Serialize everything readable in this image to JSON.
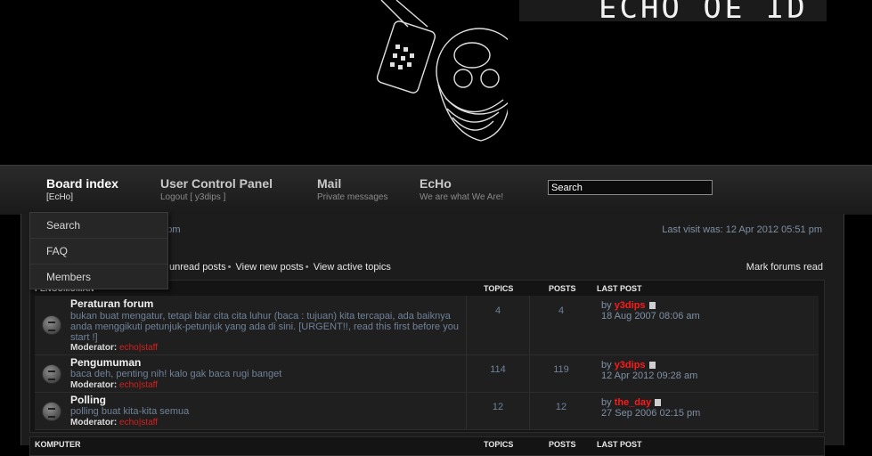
{
  "header": {
    "logo_text": "ECHO OF ID"
  },
  "nav": [
    {
      "title": "Board index",
      "sub": "[EcHo]"
    },
    {
      "title": "User Control Panel",
      "sub": "Logout [ y3dips ]"
    },
    {
      "title": "Mail",
      "sub": "Private messages"
    },
    {
      "title": "EcHo",
      "sub": "We are what We Are!"
    }
  ],
  "search": {
    "value": "Search"
  },
  "dropdown": [
    "Search",
    "FAQ",
    "Members"
  ],
  "info": {
    "time_partial": "16 pm",
    "last_visit": "Last visit was: 12 Apr 2012 05:51 pm"
  },
  "quicklinks": [
    "unread posts",
    "View new posts",
    "View active topics"
  ],
  "mark_read": "Mark forums read",
  "category1": {
    "name": "PENGUMUMAN",
    "col_topics": "TOPICS",
    "col_posts": "POSTS",
    "col_last": "LAST POST"
  },
  "category2": {
    "name": "KOMPUTER",
    "col_topics": "TOPICS",
    "col_posts": "POSTS",
    "col_last": "LAST POST"
  },
  "forums": [
    {
      "title": "Peraturan forum",
      "desc": "bukan buat mengatur, tetapi biar cita cita luhur (baca : tujuan) kita tercapai, ada baiknya anda menggikuti petunjuk-petunjuk yang ada di sini. [URGENT!!, read this first before you start !]",
      "moderator_label": "Moderator:",
      "moderator": "echo|staff",
      "topics": "4",
      "posts": "4",
      "by": "by",
      "last_user": "y3dips",
      "last_date": "18 Aug 2007 08:06 am"
    },
    {
      "title": "Pengumuman",
      "desc": "baca deh, penting nih! kalo gak baca rugi banget",
      "moderator_label": "Moderator:",
      "moderator": "echo|staff",
      "topics": "114",
      "posts": "119",
      "by": "by",
      "last_user": "y3dips",
      "last_date": "12 Apr 2012 09:28 am"
    },
    {
      "title": "Polling",
      "desc": "polling buat kita-kita semua",
      "moderator_label": "Moderator:",
      "moderator": "echo|staff",
      "topics": "12",
      "posts": "12",
      "by": "by",
      "last_user": "the_day",
      "last_date": "27 Sep 2006 02:15 pm"
    }
  ]
}
